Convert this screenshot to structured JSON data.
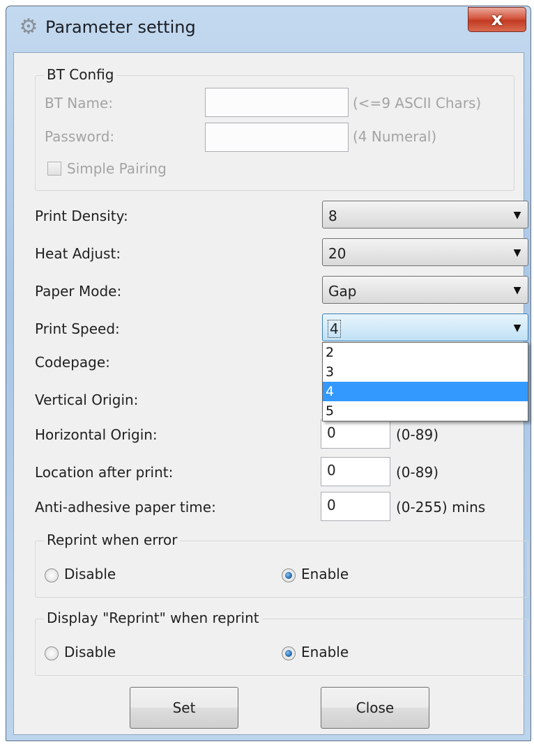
{
  "window": {
    "title": "Parameter setting",
    "icon": "gear-icon",
    "close_glyph": "x"
  },
  "bt_config": {
    "group_label": "BT Config",
    "bt_name_label": "BT Name:",
    "bt_name_value": "",
    "bt_name_hint": "(<=9 ASCII Chars)",
    "password_label": "Password:",
    "password_value": "",
    "password_hint": "(4 Numeral)",
    "simple_pairing_label": "Simple Pairing",
    "simple_pairing_checked": false,
    "enabled": false
  },
  "settings": {
    "print_density": {
      "label": "Print Density:",
      "value": "8"
    },
    "heat_adjust": {
      "label": "Heat Adjust:",
      "value": "20"
    },
    "paper_mode": {
      "label": "Paper Mode:",
      "value": "Gap"
    },
    "print_speed": {
      "label": "Print Speed:",
      "value": "4",
      "options": [
        "2",
        "3",
        "4",
        "5"
      ],
      "selected_option": "4"
    },
    "codepage": {
      "label": "Codepage:"
    },
    "vertical_origin": {
      "label": "Vertical Origin:"
    },
    "horizontal_origin": {
      "label": "Horizontal Origin:",
      "value": "0",
      "hint": "(0-89)"
    },
    "location_after_print": {
      "label": "Location after print:",
      "value": "0",
      "hint": "(0-89)"
    },
    "anti_adhesive": {
      "label": "Anti-adhesive paper time:",
      "value": "0",
      "hint": "(0-255) mins"
    }
  },
  "reprint_when_error": {
    "group_label": "Reprint when error",
    "disable_label": "Disable",
    "enable_label": "Enable",
    "selected": "Enable"
  },
  "display_reprint": {
    "group_label": "Display \"Reprint\" when reprint",
    "disable_label": "Disable",
    "enable_label": "Enable",
    "selected": "Enable"
  },
  "buttons": {
    "set_label": "Set",
    "close_label": "Close"
  },
  "colors": {
    "selection": "#3399ff",
    "radio_selected": "#2a6fb5",
    "close_button": "#c23b23",
    "disabled_text": "#a3a3a3"
  }
}
